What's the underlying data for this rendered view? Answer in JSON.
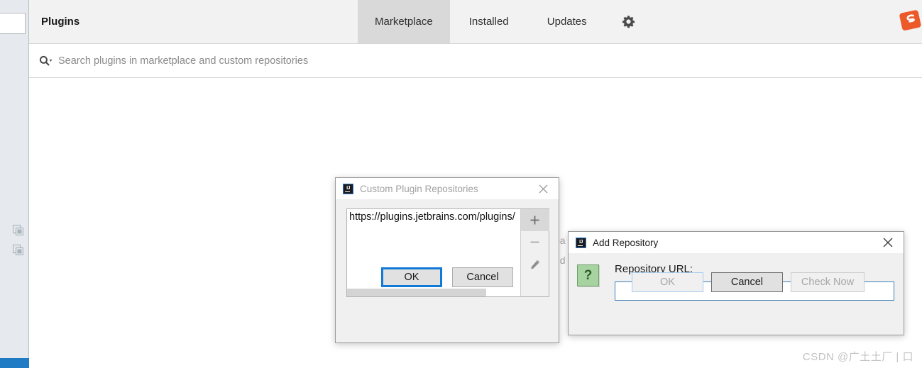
{
  "app": {
    "panel_title": "Plugins"
  },
  "tabs": [
    {
      "label": "Marketplace",
      "selected": true
    },
    {
      "label": "Installed",
      "selected": false
    },
    {
      "label": "Updates",
      "selected": false
    }
  ],
  "toolbar": {
    "gear_icon": "gear-icon"
  },
  "search": {
    "placeholder": "Search plugins in marketplace and custom repositories",
    "value": "",
    "icon": "search-icon"
  },
  "background_text": {
    "fragment_1": "ba",
    "fragment_2": "nd"
  },
  "left_rail": {
    "icon_1": "copy-icon",
    "icon_2": "copy-icon"
  },
  "ime_badge": {
    "name": "sogou-ime-icon",
    "letter": "S",
    "color": "#ec5a2a"
  },
  "watermark": {
    "text": "CSDN @广土土厂 | 口"
  },
  "dialog_repositories": {
    "title": "Custom Plugin Repositories",
    "app_icon": "intellij-icon",
    "close_icon": "close-icon",
    "items": [
      "https://plugins.jetbrains.com/plugins/"
    ],
    "toolbar_buttons": [
      {
        "name": "add-repository-button",
        "icon": "plus-icon"
      },
      {
        "name": "remove-repository-button",
        "icon": "minus-icon"
      },
      {
        "name": "edit-repository-button",
        "icon": "pencil-icon"
      }
    ],
    "buttons": {
      "ok": "OK",
      "cancel": "Cancel"
    },
    "accent_focus_color": "#1379d6"
  },
  "dialog_add_repository": {
    "title": "Add Repository",
    "app_icon": "intellij-icon",
    "close_icon": "close-icon",
    "help_icon": "question-icon",
    "help_glyph": "?",
    "field_label": "Repository URL:",
    "field_value": "",
    "field_placeholder": "",
    "buttons": {
      "ok": "OK",
      "cancel": "Cancel",
      "check_now": "Check Now"
    },
    "ok_enabled": false,
    "check_now_enabled": false,
    "input_border_color": "#3f7fb8"
  }
}
